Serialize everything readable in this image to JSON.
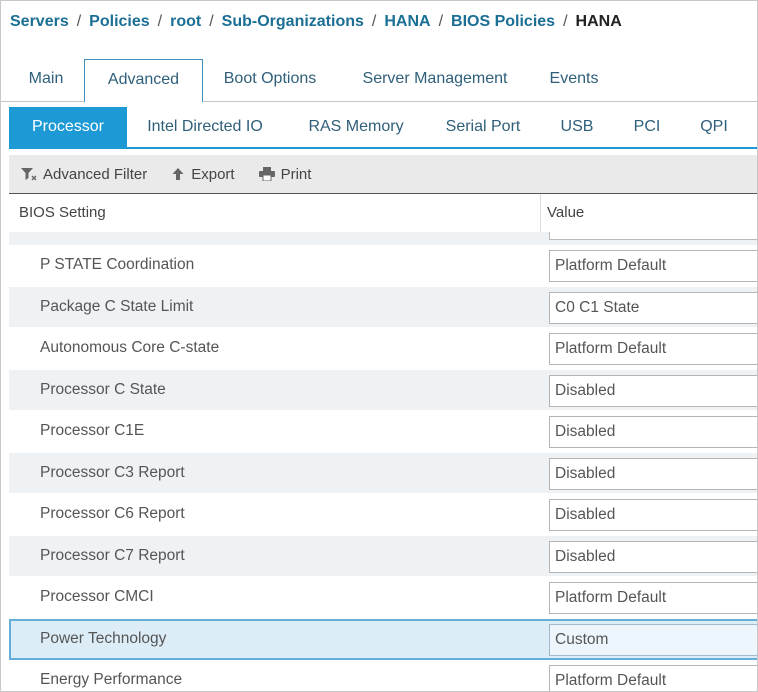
{
  "breadcrumb": [
    {
      "label": "Servers"
    },
    {
      "label": "Policies"
    },
    {
      "label": "root"
    },
    {
      "label": "Sub-Organizations"
    },
    {
      "label": "HANA"
    },
    {
      "label": "BIOS Policies"
    },
    {
      "label": "HANA"
    }
  ],
  "tabs": [
    "Main",
    "Advanced",
    "Boot Options",
    "Server Management",
    "Events"
  ],
  "active_tab": "Advanced",
  "subtabs": [
    "Processor",
    "Intel Directed IO",
    "RAS Memory",
    "Serial Port",
    "USB",
    "PCI",
    "QPI"
  ],
  "active_subtab": "Processor",
  "toolbar": {
    "filter_label": "Advanced Filter",
    "export_label": "Export",
    "print_label": "Print"
  },
  "table": {
    "columns": [
      "BIOS Setting",
      "Value"
    ],
    "rows": [
      {
        "setting": "P STATE Coordination",
        "value": "Platform Default"
      },
      {
        "setting": "Package C State Limit",
        "value": "C0 C1 State"
      },
      {
        "setting": "Autonomous Core C-state",
        "value": "Platform Default"
      },
      {
        "setting": "Processor C State",
        "value": "Disabled"
      },
      {
        "setting": "Processor C1E",
        "value": "Disabled"
      },
      {
        "setting": "Processor C3 Report",
        "value": "Disabled"
      },
      {
        "setting": "Processor C6 Report",
        "value": "Disabled"
      },
      {
        "setting": "Processor C7 Report",
        "value": "Disabled"
      },
      {
        "setting": "Processor CMCI",
        "value": "Platform Default"
      },
      {
        "setting": "Power Technology",
        "value": "Custom"
      },
      {
        "setting": "Energy Performance",
        "value": "Platform Default"
      }
    ],
    "selected_setting": "Power Technology"
  },
  "colors": {
    "link": "#1b6e94",
    "accent": "#1d9ad6",
    "row_alt": "#eef2f5",
    "selected_row": "#dcedf8"
  }
}
